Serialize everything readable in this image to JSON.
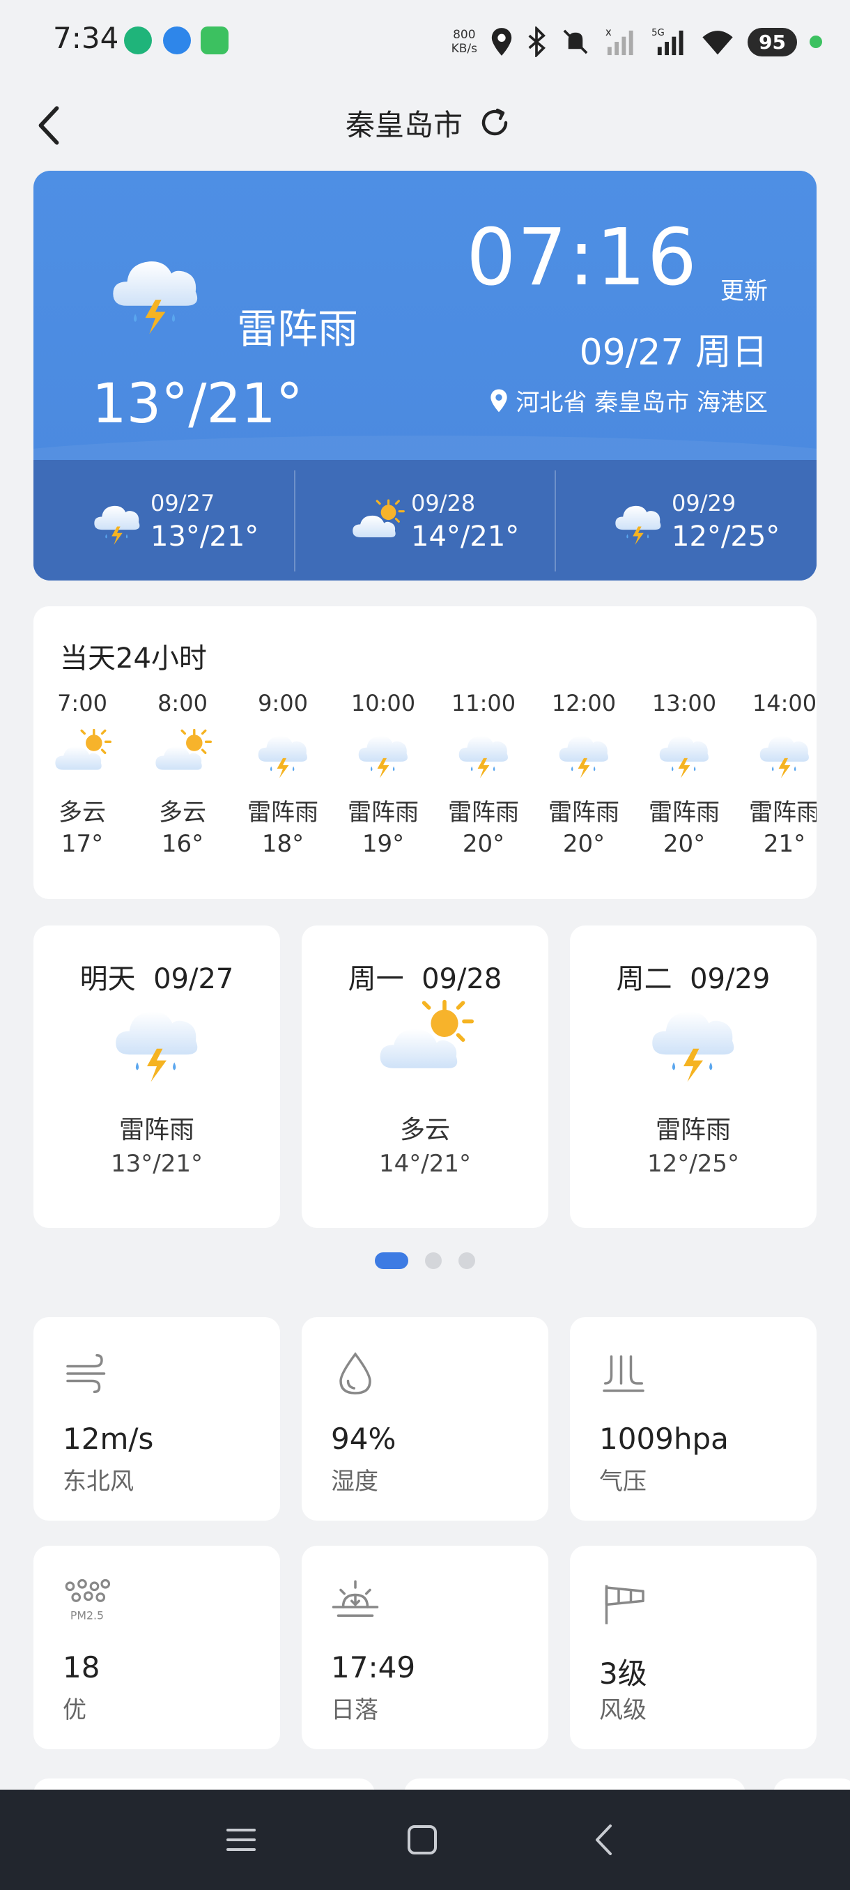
{
  "status_bar": {
    "time": "7:34",
    "net_speed_value": "800",
    "net_speed_unit": "KB/s",
    "battery": "95"
  },
  "header": {
    "city": "秦皇岛市"
  },
  "current": {
    "condition": "雷阵雨",
    "temp_range": "13°/21°",
    "update_time": "07:16",
    "update_label": "更新",
    "date": "09/27 周日",
    "location": "河北省 秦皇岛市 海港区",
    "forecast": [
      {
        "date": "09/27",
        "range": "13°/21°",
        "icon": "thunder-rain"
      },
      {
        "date": "09/28",
        "range": "14°/21°",
        "icon": "partly-cloudy"
      },
      {
        "date": "09/29",
        "range": "12°/25°",
        "icon": "thunder-rain"
      }
    ]
  },
  "hourly": {
    "title": "当天24小时",
    "items": [
      {
        "time": "7:00",
        "cond": "多云",
        "temp": "17°",
        "icon": "partly-cloudy"
      },
      {
        "time": "8:00",
        "cond": "多云",
        "temp": "16°",
        "icon": "partly-cloudy"
      },
      {
        "time": "9:00",
        "cond": "雷阵雨",
        "temp": "18°",
        "icon": "thunder-rain"
      },
      {
        "time": "10:00",
        "cond": "雷阵雨",
        "temp": "19°",
        "icon": "thunder-rain"
      },
      {
        "time": "11:00",
        "cond": "雷阵雨",
        "temp": "20°",
        "icon": "thunder-rain"
      },
      {
        "time": "12:00",
        "cond": "雷阵雨",
        "temp": "20°",
        "icon": "thunder-rain"
      },
      {
        "time": "13:00",
        "cond": "雷阵雨",
        "temp": "20°",
        "icon": "thunder-rain"
      },
      {
        "time": "14:00",
        "cond": "雷阵雨",
        "temp": "21°",
        "icon": "thunder-rain"
      }
    ]
  },
  "daily": [
    {
      "day": "明天",
      "date": "09/27",
      "cond": "雷阵雨",
      "range": "13°/21°",
      "icon": "thunder-rain"
    },
    {
      "day": "周一",
      "date": "09/28",
      "cond": "多云",
      "range": "14°/21°",
      "icon": "partly-cloudy"
    },
    {
      "day": "周二",
      "date": "09/29",
      "cond": "雷阵雨",
      "range": "12°/25°",
      "icon": "thunder-rain"
    }
  ],
  "pager": {
    "count": 3,
    "active": 0
  },
  "details": [
    {
      "value": "12m/s",
      "label": "东北风",
      "icon": "wind-icon"
    },
    {
      "value": "94%",
      "label": "湿度",
      "icon": "humidity-icon"
    },
    {
      "value": "1009hpa",
      "label": "气压",
      "icon": "pressure-icon"
    },
    {
      "value": "18",
      "label": "优",
      "icon": "pm25-icon",
      "icon_text": "PM2.5"
    },
    {
      "value": "17:49",
      "label": "日落",
      "icon": "sunset-icon"
    },
    {
      "value": "3级",
      "label": "风级",
      "icon": "windsock-icon"
    }
  ],
  "colors": {
    "card_blue": "#4e8fe4",
    "card_band": "#3e6cb8",
    "accent": "#3d7be3",
    "background": "#f1f2f4",
    "navbar": "#22262e"
  }
}
